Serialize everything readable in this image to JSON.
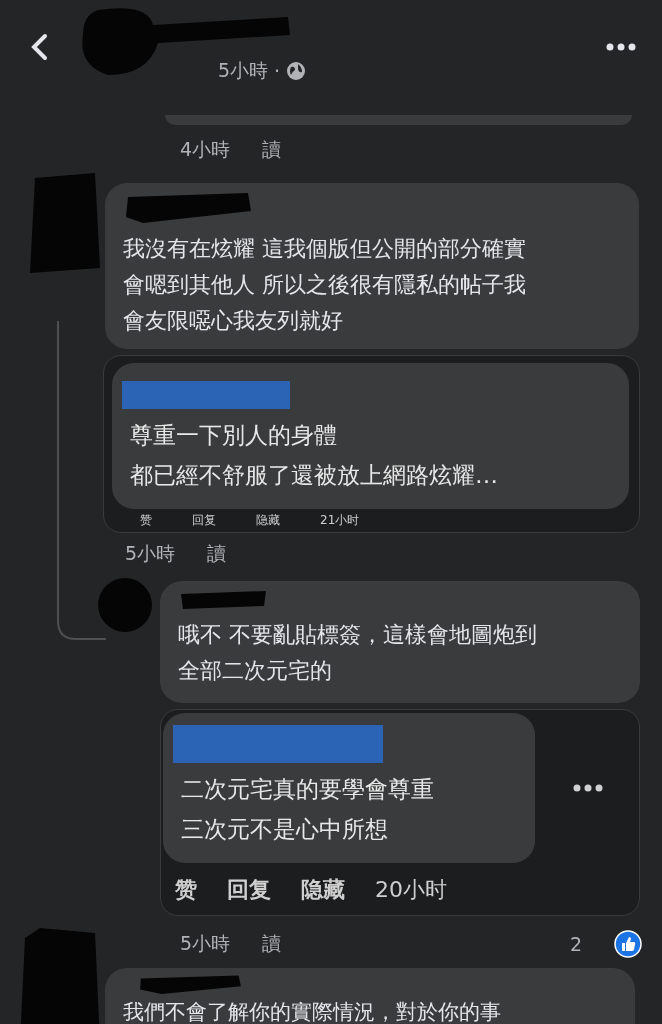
{
  "header": {
    "time": "5小時",
    "separator": "·"
  },
  "top_comment": {
    "time": "4小時",
    "read_label": "讀"
  },
  "comment": {
    "lines": [
      "我沒有在炫耀 這我個版但公開的部分確實",
      "會嗯到其他人 所以之後很有隱私的帖子我",
      "會友限噁心我友列就好"
    ],
    "screenshot": {
      "lines": [
        "尊重一下別人的身體",
        "都已經不舒服了還被放上網路炫耀…"
      ],
      "actions": [
        "赞",
        "回复",
        "隐藏",
        "21小时"
      ]
    },
    "time": "5小時",
    "read_label": "讀"
  },
  "reply": {
    "lines": [
      "哦不 不要亂貼標簽，這樣會地圖炮到",
      "全部二次元宅的"
    ],
    "screenshot": {
      "lines": [
        "二次元宅真的要學會尊重",
        "三次元不是心中所想"
      ],
      "actions": [
        "赞",
        "回复",
        "隐藏",
        "20小时"
      ]
    },
    "time": "5小時",
    "read_label": "讀",
    "like_count": "2"
  },
  "last_comment": {
    "lines": [
      "我們不會了解你的實際情況，對於你的事"
    ]
  }
}
